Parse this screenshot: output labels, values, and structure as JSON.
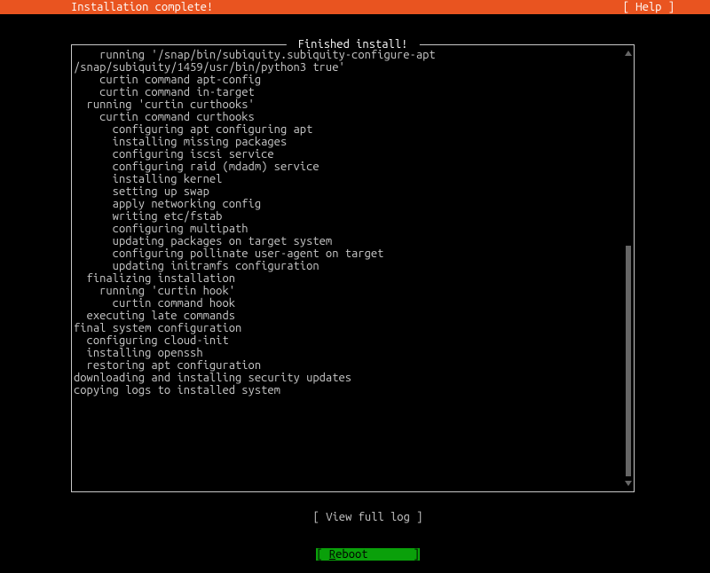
{
  "header": {
    "title": "Installation complete!",
    "help_label": "[ Help ]"
  },
  "panel": {
    "title": " Finished install! ",
    "log_lines": [
      "    running '/snap/bin/subiquity.subiquity-configure-apt",
      "/snap/subiquity/1459/usr/bin/python3 true'",
      "    curtin command apt-config",
      "    curtin command in-target",
      "  running 'curtin curthooks'",
      "    curtin command curthooks",
      "      configuring apt configuring apt",
      "      installing missing packages",
      "      configuring iscsi service",
      "      configuring raid (mdadm) service",
      "      installing kernel",
      "      setting up swap",
      "      apply networking config",
      "      writing etc/fstab",
      "      configuring multipath",
      "      updating packages on target system",
      "      configuring pollinate user-agent on target",
      "      updating initramfs configuration",
      "  finalizing installation",
      "    running 'curtin hook'",
      "      curtin command hook",
      "  executing late commands",
      "final system configuration",
      "  configuring cloud-init",
      "  installing openssh",
      "  restoring apt configuration",
      "downloading and installing security updates",
      "copying logs to installed system"
    ]
  },
  "buttons": {
    "view_full_log": "[ View full log ]",
    "reboot_prefix": "[ ",
    "reboot_hotkey": "R",
    "reboot_rest": "eboot       ",
    "reboot_suffix": "]"
  }
}
